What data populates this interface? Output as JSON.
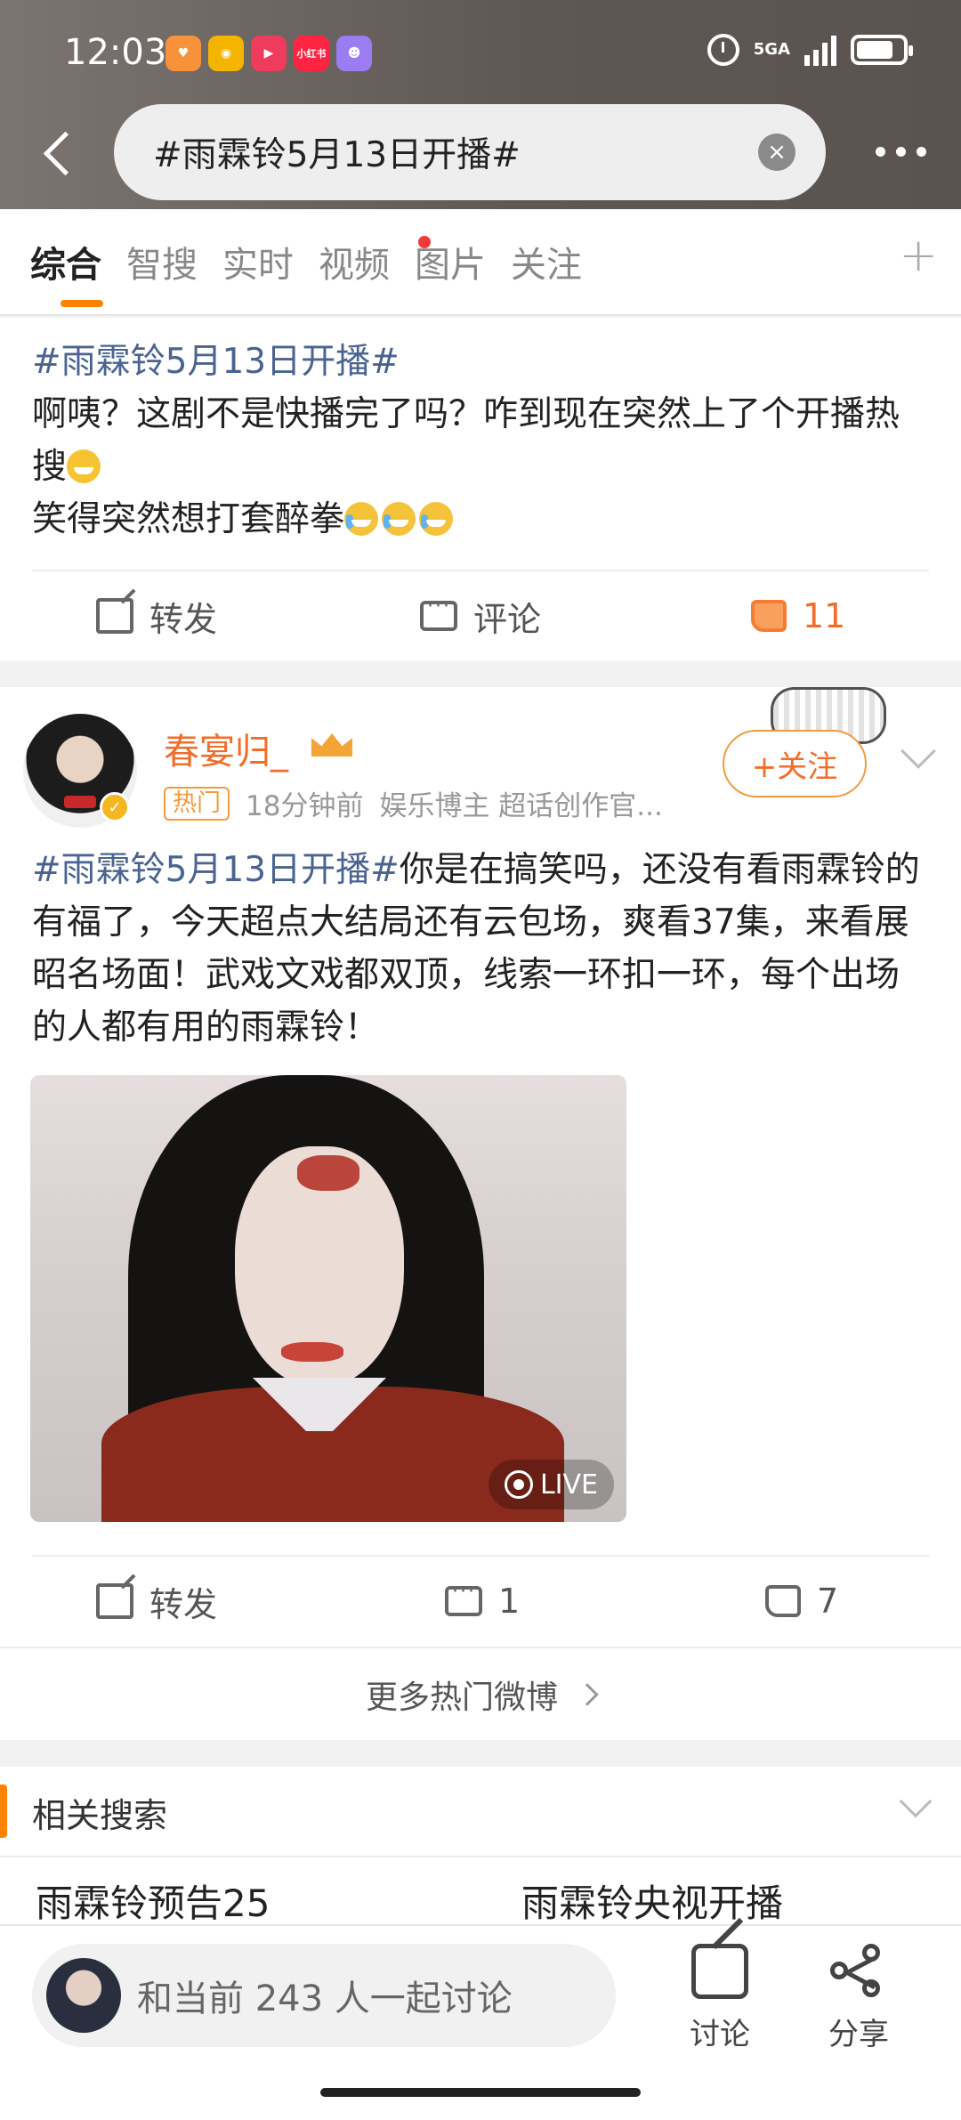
{
  "status_bar": {
    "time": "12:03",
    "apps": [
      {
        "name": "heart-app-icon",
        "color": "#f7923a",
        "glyph": "♥"
      },
      {
        "name": "weibo-app-icon",
        "color": "#f5b400",
        "glyph": "◉"
      },
      {
        "name": "video-app-icon",
        "color": "#ef3b5c",
        "glyph": "▶"
      },
      {
        "name": "xiaohongshu-app-icon",
        "color": "#ff2442",
        "glyph": "小红书"
      },
      {
        "name": "chat-app-icon",
        "color": "#9b7cf2",
        "glyph": "☻"
      }
    ],
    "network": "5GA",
    "battery_level": 0.8
  },
  "search": {
    "query": "#雨霖铃5月13日开播#",
    "clear_icon": "×"
  },
  "tabs": [
    {
      "label": "综合",
      "active": true
    },
    {
      "label": "智搜",
      "active": false
    },
    {
      "label": "实时",
      "active": false,
      "has_dot": true
    },
    {
      "label": "视频",
      "active": false
    },
    {
      "label": "图片",
      "active": false
    },
    {
      "label": "关注",
      "active": false
    }
  ],
  "tab_add": "+",
  "post1": {
    "topic": "#雨霖铃5月13日开播#",
    "line1": "啊咦？这剧不是快播完了吗？咋到现在突然上了个开播热搜",
    "line2": "笑得突然想打套醉拳",
    "repost_label": "转发",
    "comment_label": "评论",
    "like_count": "11"
  },
  "post2": {
    "username": "春宴归_",
    "hot_badge": "热门",
    "time": "18分钟前",
    "role": "娱乐博主 超话创作官...",
    "follow_label": "+关注",
    "topic": "#雨霖铃5月13日开播#",
    "body": "你是在搞笑吗，还没有看雨霖铃的有福了，今天超点大结局还有云包场，爽看37集，来看展昭名场面！武戏文戏都双顶，线索一环扣一环，每个出场的人都有用的雨霖铃！",
    "live_label": "LIVE",
    "repost_label": "转发",
    "comment_count": "1",
    "like_count": "7",
    "more_hot": "更多热门微博"
  },
  "related": {
    "title": "相关搜索",
    "items": [
      "雨霖铃预告25",
      "雨霖铃央视开播"
    ]
  },
  "bottom": {
    "discuss_text": "和当前 243 人一起讨论",
    "discuss_label": "讨论",
    "share_label": "分享"
  },
  "colors": {
    "accent": "#ff8200",
    "topic": "#4a6392",
    "username": "#f26d2a"
  }
}
